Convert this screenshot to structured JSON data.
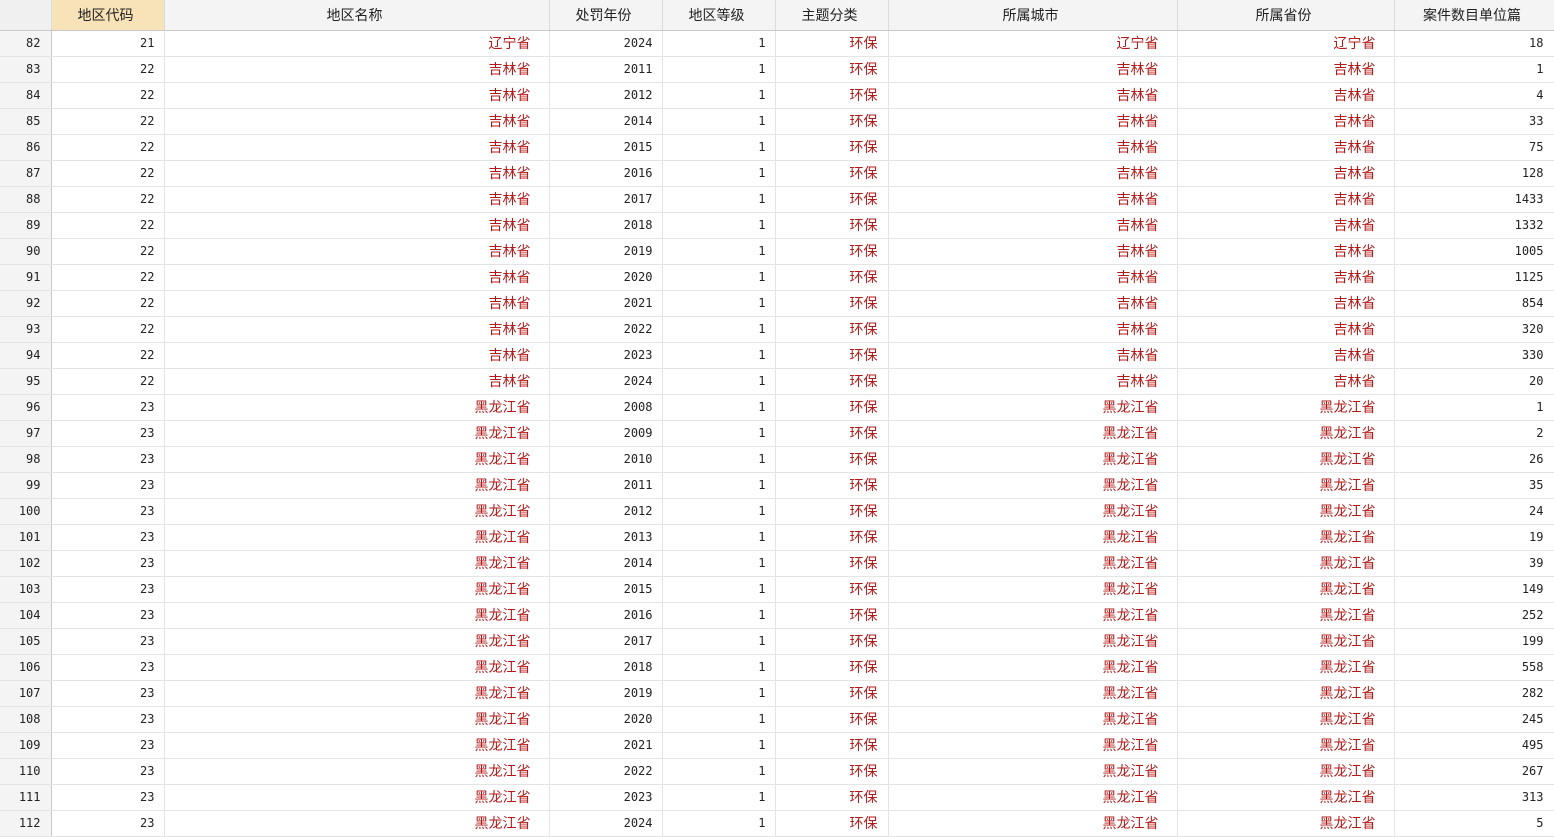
{
  "columns": [
    {
      "label": "",
      "name": "obs"
    },
    {
      "label": "地区代码",
      "name": "region-code"
    },
    {
      "label": "地区名称",
      "name": "region-name"
    },
    {
      "label": "处罚年份",
      "name": "penalty-year"
    },
    {
      "label": "地区等级",
      "name": "region-level"
    },
    {
      "label": "主题分类",
      "name": "topic-category"
    },
    {
      "label": "所属城市",
      "name": "city"
    },
    {
      "label": "所属省份",
      "name": "province"
    },
    {
      "label": "案件数目单位篇",
      "name": "case-count"
    }
  ],
  "colors": {
    "header_bg": "#f4f4f4",
    "sorted_header_bg": "#f8e3b8",
    "string_text": "#b21a1a",
    "numeric_text": "#222222",
    "grid_line": "#e4e4e4"
  },
  "rows": [
    [
      "82",
      "21",
      "辽宁省",
      "2024",
      "1",
      "环保",
      "辽宁省",
      "辽宁省",
      "18"
    ],
    [
      "83",
      "22",
      "吉林省",
      "2011",
      "1",
      "环保",
      "吉林省",
      "吉林省",
      "1"
    ],
    [
      "84",
      "22",
      "吉林省",
      "2012",
      "1",
      "环保",
      "吉林省",
      "吉林省",
      "4"
    ],
    [
      "85",
      "22",
      "吉林省",
      "2014",
      "1",
      "环保",
      "吉林省",
      "吉林省",
      "33"
    ],
    [
      "86",
      "22",
      "吉林省",
      "2015",
      "1",
      "环保",
      "吉林省",
      "吉林省",
      "75"
    ],
    [
      "87",
      "22",
      "吉林省",
      "2016",
      "1",
      "环保",
      "吉林省",
      "吉林省",
      "128"
    ],
    [
      "88",
      "22",
      "吉林省",
      "2017",
      "1",
      "环保",
      "吉林省",
      "吉林省",
      "1433"
    ],
    [
      "89",
      "22",
      "吉林省",
      "2018",
      "1",
      "环保",
      "吉林省",
      "吉林省",
      "1332"
    ],
    [
      "90",
      "22",
      "吉林省",
      "2019",
      "1",
      "环保",
      "吉林省",
      "吉林省",
      "1005"
    ],
    [
      "91",
      "22",
      "吉林省",
      "2020",
      "1",
      "环保",
      "吉林省",
      "吉林省",
      "1125"
    ],
    [
      "92",
      "22",
      "吉林省",
      "2021",
      "1",
      "环保",
      "吉林省",
      "吉林省",
      "854"
    ],
    [
      "93",
      "22",
      "吉林省",
      "2022",
      "1",
      "环保",
      "吉林省",
      "吉林省",
      "320"
    ],
    [
      "94",
      "22",
      "吉林省",
      "2023",
      "1",
      "环保",
      "吉林省",
      "吉林省",
      "330"
    ],
    [
      "95",
      "22",
      "吉林省",
      "2024",
      "1",
      "环保",
      "吉林省",
      "吉林省",
      "20"
    ],
    [
      "96",
      "23",
      "黑龙江省",
      "2008",
      "1",
      "环保",
      "黑龙江省",
      "黑龙江省",
      "1"
    ],
    [
      "97",
      "23",
      "黑龙江省",
      "2009",
      "1",
      "环保",
      "黑龙江省",
      "黑龙江省",
      "2"
    ],
    [
      "98",
      "23",
      "黑龙江省",
      "2010",
      "1",
      "环保",
      "黑龙江省",
      "黑龙江省",
      "26"
    ],
    [
      "99",
      "23",
      "黑龙江省",
      "2011",
      "1",
      "环保",
      "黑龙江省",
      "黑龙江省",
      "35"
    ],
    [
      "100",
      "23",
      "黑龙江省",
      "2012",
      "1",
      "环保",
      "黑龙江省",
      "黑龙江省",
      "24"
    ],
    [
      "101",
      "23",
      "黑龙江省",
      "2013",
      "1",
      "环保",
      "黑龙江省",
      "黑龙江省",
      "19"
    ],
    [
      "102",
      "23",
      "黑龙江省",
      "2014",
      "1",
      "环保",
      "黑龙江省",
      "黑龙江省",
      "39"
    ],
    [
      "103",
      "23",
      "黑龙江省",
      "2015",
      "1",
      "环保",
      "黑龙江省",
      "黑龙江省",
      "149"
    ],
    [
      "104",
      "23",
      "黑龙江省",
      "2016",
      "1",
      "环保",
      "黑龙江省",
      "黑龙江省",
      "252"
    ],
    [
      "105",
      "23",
      "黑龙江省",
      "2017",
      "1",
      "环保",
      "黑龙江省",
      "黑龙江省",
      "199"
    ],
    [
      "106",
      "23",
      "黑龙江省",
      "2018",
      "1",
      "环保",
      "黑龙江省",
      "黑龙江省",
      "558"
    ],
    [
      "107",
      "23",
      "黑龙江省",
      "2019",
      "1",
      "环保",
      "黑龙江省",
      "黑龙江省",
      "282"
    ],
    [
      "108",
      "23",
      "黑龙江省",
      "2020",
      "1",
      "环保",
      "黑龙江省",
      "黑龙江省",
      "245"
    ],
    [
      "109",
      "23",
      "黑龙江省",
      "2021",
      "1",
      "环保",
      "黑龙江省",
      "黑龙江省",
      "495"
    ],
    [
      "110",
      "23",
      "黑龙江省",
      "2022",
      "1",
      "环保",
      "黑龙江省",
      "黑龙江省",
      "267"
    ],
    [
      "111",
      "23",
      "黑龙江省",
      "2023",
      "1",
      "环保",
      "黑龙江省",
      "黑龙江省",
      "313"
    ],
    [
      "112",
      "23",
      "黑龙江省",
      "2024",
      "1",
      "环保",
      "黑龙江省",
      "黑龙江省",
      "5"
    ]
  ]
}
